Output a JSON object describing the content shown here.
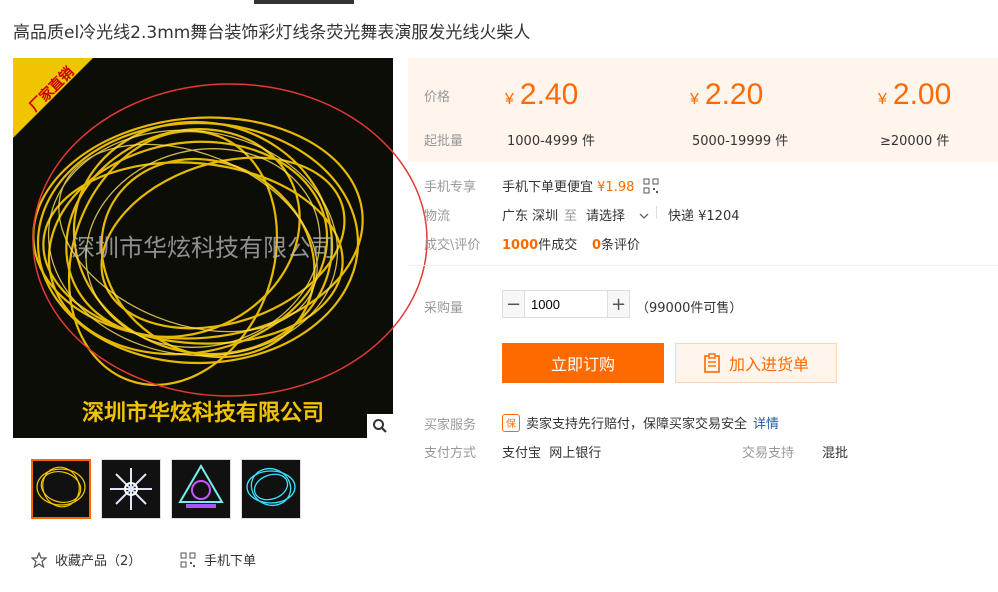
{
  "product": {
    "title": "高品质el冷光线2.3mm舞台装饰彩灯线条荧光舞表演服发光线火柴人",
    "image_badge": "厂家直销",
    "image_watermark": "深圳市华炫科技有限公司",
    "image_footer": "深圳市华炫科技有限公司"
  },
  "pricing": {
    "price_label": "价格",
    "moq_label": "起批量",
    "currency": "¥",
    "tiers": [
      {
        "price": "2.40",
        "range": "1000-4999 件"
      },
      {
        "price": "2.20",
        "range": "5000-19999 件"
      },
      {
        "price": "2.00",
        "range": "≥20000 件"
      }
    ]
  },
  "mobile": {
    "label": "手机专享",
    "text": "手机下单更便宜",
    "price": "¥1.98"
  },
  "logistics": {
    "label": "物流",
    "from": "广东 深圳",
    "to_word": "至",
    "select": "请选择",
    "shipping": "快递 ¥1204"
  },
  "deals": {
    "label": "成交\\评价",
    "count": "1000",
    "count_suffix": "件成交",
    "reviews": "0",
    "reviews_suffix": "条评价"
  },
  "purchase": {
    "label": "采购量",
    "minus": "−",
    "plus": "+",
    "quantity": "1000",
    "stock": "（99000件可售）"
  },
  "actions": {
    "buy": "立即订购",
    "cart": "加入进货单"
  },
  "service": {
    "label": "买家服务",
    "badge": "保",
    "text": "卖家支持先行赔付，保障买家交易安全",
    "detail": "详情"
  },
  "payment": {
    "label": "支付方式",
    "methods": "支付宝  网上银行",
    "trade_label": "交易支持",
    "trade_value": "混批"
  },
  "bottom": {
    "favorite": "收藏产品（2）",
    "mobile_order": "手机下单"
  },
  "colors": {
    "accent": "#ff6a00",
    "price_bg": "#fff5ed",
    "link": "#2458a6"
  }
}
